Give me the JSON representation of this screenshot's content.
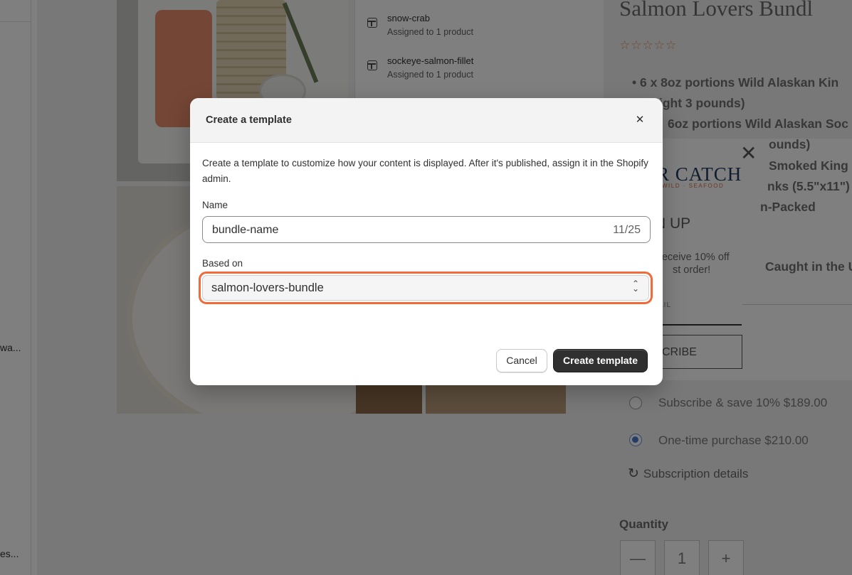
{
  "sidebar": {
    "truncated_item_1": "wa...",
    "truncated_item_2": "es..."
  },
  "templates": [
    {
      "name": "snow-crab",
      "assigned": "Assigned to 1 product"
    },
    {
      "name": "sockeye-salmon-fillet",
      "assigned": "Assigned to 1 product"
    }
  ],
  "product": {
    "title": "Salmon Lovers Bundl",
    "stars": "☆☆☆☆☆",
    "bullets": [
      "•  6 x 8oz portions Wild Alaskan Kin",
      "ight 3 pounds)",
      "6oz portions Wild Alaskan Soc",
      "ounds)",
      "Smoked King",
      "nks (5.5\"x11\")",
      "n-Packed"
    ],
    "caught_text": "Caught in the U",
    "purchase_options": [
      {
        "label": "Subscribe & save 10% $189.00",
        "checked": false
      },
      {
        "label": "One-time purchase $210.00",
        "checked": true
      }
    ],
    "subscription_details": "Subscription details",
    "quantity_label": "Quantity",
    "quantity_minus": "—",
    "quantity_value": "1",
    "quantity_plus": "+"
  },
  "popup": {
    "close": "✕",
    "logo": "R CATCH",
    "logo_sub": "WILD · SEAFOOD",
    "heading": "N UP",
    "text_line1": "receive 10% off",
    "text_line2": "st order!",
    "email_placeholder": "AIL",
    "subscribe": "CRIBE"
  },
  "modal": {
    "title": "Create a template",
    "close_icon": "✕",
    "description": "Create a template to customize how your content is displayed. After it's published, assign it in the Shopify admin.",
    "name_label": "Name",
    "name_value": "bundle-name",
    "name_count": "11/25",
    "based_on_label": "Based on",
    "based_on_value": "salmon-lovers-bundle",
    "cancel_label": "Cancel",
    "create_label": "Create template"
  },
  "colors": {
    "highlight_ring": "#f06a3a",
    "primary_button": "#303030",
    "overlay": "rgba(0,0,0,0.5)"
  }
}
